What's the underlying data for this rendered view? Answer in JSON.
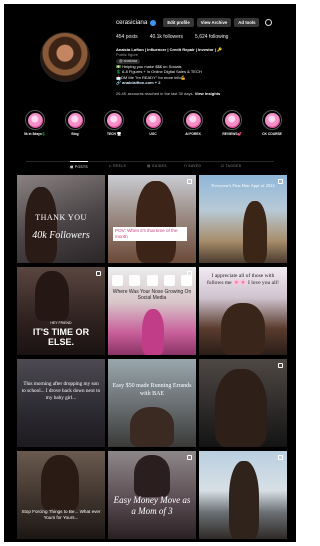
{
  "profile": {
    "username": "cerasiciana",
    "buttons": {
      "edit_profile": "Edit profile",
      "view_archive": "View Archive",
      "ad_tools": "Ad tools"
    },
    "stats": {
      "posts": "454 posts",
      "followers": "40.1k followers",
      "following": "5,624 following"
    },
    "bio": {
      "name": "Anaicia Lofton | Influencer | Credit Repair | Investor | 🔑",
      "category": "Public figure",
      "pill": "@ anaiciaa",
      "lines": [
        "💵 Helping you make $$$ on Socials",
        "💲 6-8 Figures + in Online Digital Sales & TECH",
        "📩DM Me \"Im READY\" for more info💪",
        "🔗 anaiciaifton.com + 2"
      ]
    },
    "insights_text": "26.4K accounts reached in the last 30 days.",
    "insights_link": "View insights"
  },
  "highlights": [
    {
      "label": "5k in 5days💲"
    },
    {
      "label": "Blog"
    },
    {
      "label": "TECH 🖥"
    },
    {
      "label": "UGC"
    },
    {
      "label": "AI FOREX"
    },
    {
      "label": "REVIEWS💕"
    },
    {
      "label": "CK COURSE"
    }
  ],
  "tabs": [
    "POSTS",
    "REELS",
    "GUIDES",
    "SAVED",
    "TAGGED"
  ],
  "posts": [
    {
      "caption": "THANK YOU",
      "caption2": "40k Followers"
    },
    {
      "caption": "POV: When it's that time of the month"
    },
    {
      "caption": "Everyone's First Hair Appt of 2024"
    },
    {
      "caption": "IT'S TIME OR ELSE.",
      "caption2": "HEY FRIEND"
    },
    {
      "caption": "Where Was Your Nose Growing On Social Media"
    },
    {
      "caption": "I appreciate all of those with follows me 🌸🌸 I love you all!"
    },
    {
      "caption": "This morning after dropping my son to school... I drove back down next to my baby girl..."
    },
    {
      "caption": "Easy $50 made Running Errands with BAE"
    },
    {
      "caption": ""
    },
    {
      "caption": "Stop Forcing Things to Be... What ever Yours for Yours..."
    },
    {
      "caption": "Easy Money Move as a Mom of 3"
    },
    {
      "caption": ""
    }
  ],
  "colors": {
    "accent_blue": "#3897f0",
    "highlight_pink": "#e0569f",
    "background": "#000000"
  },
  "icons": [
    "verified-badge-icon",
    "settings-gear-icon",
    "grid-icon",
    "reels-icon",
    "guides-icon",
    "saved-icon",
    "tagged-icon",
    "multi-post-icon"
  ]
}
